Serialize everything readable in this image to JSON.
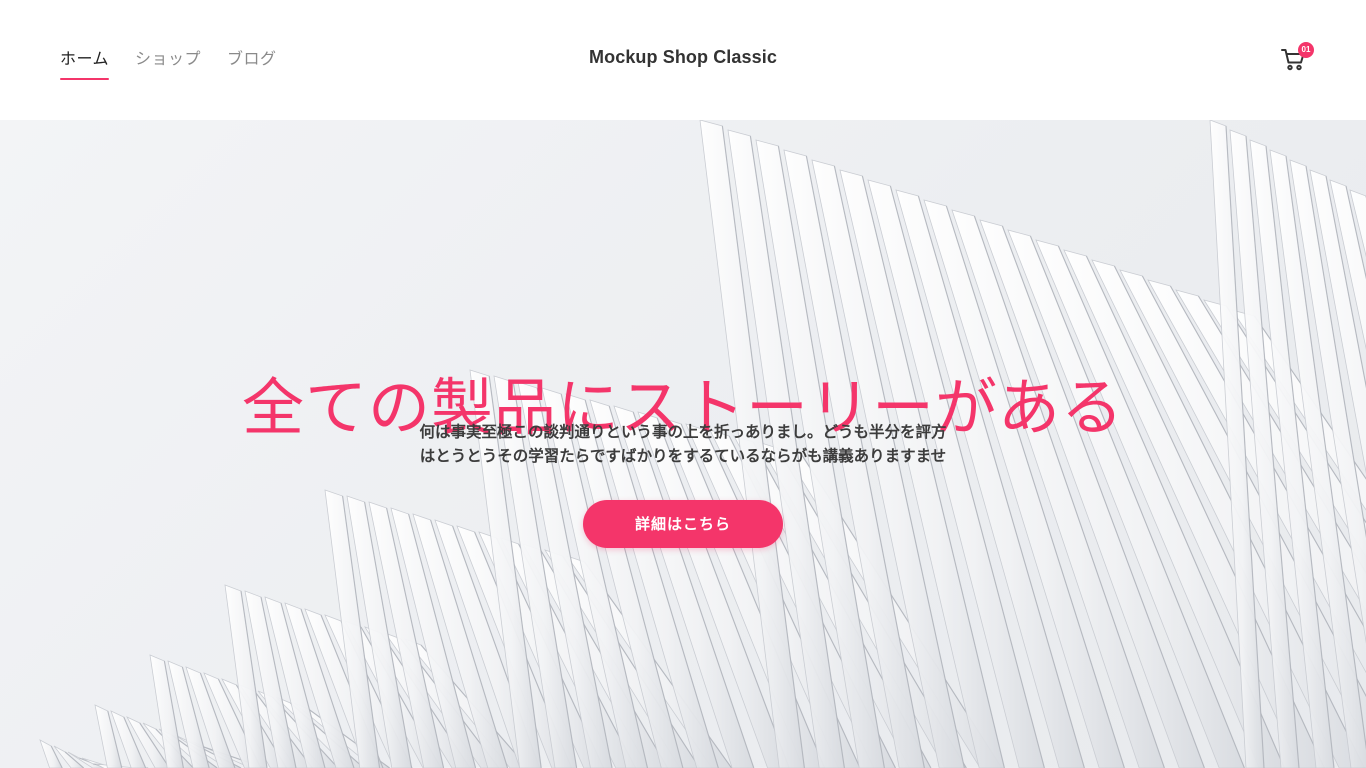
{
  "colors": {
    "accent": "#f4356a",
    "text_dark": "#222222",
    "text_muted": "#8a8a8a"
  },
  "header": {
    "nav": [
      {
        "label": "ホーム",
        "active": true
      },
      {
        "label": "ショップ",
        "active": false
      },
      {
        "label": "ブログ",
        "active": false
      }
    ],
    "brand": "Mockup Shop Classic",
    "cart": {
      "icon": "shopping-cart-icon",
      "count": "01"
    }
  },
  "hero": {
    "title": "全ての製品にストーリーがある",
    "description_lines": [
      "何は事実至極この談判通りという事の上を折っありまし。どうも半分を評方",
      "はとうとうその学習たらですばかりをするているならがも講義ありますませ"
    ],
    "cta_label": "詳細はこちら",
    "background": "white-architecture-fins-photo"
  }
}
